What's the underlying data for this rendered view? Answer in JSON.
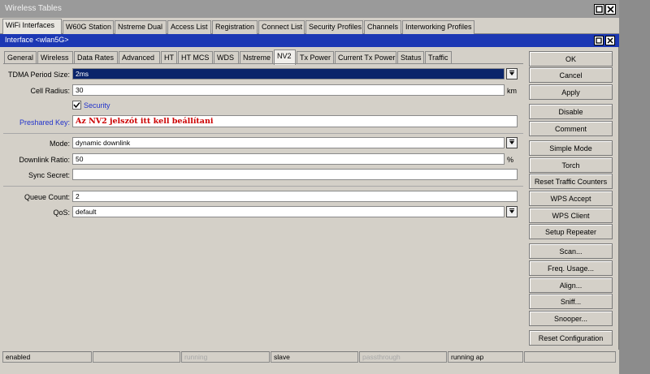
{
  "window": {
    "title": "Wireless Tables"
  },
  "outer_tabs": [
    "WiFi Interfaces",
    "W60G Station",
    "Nstreme Dual",
    "Access List",
    "Registration",
    "Connect List",
    "Security Profiles",
    "Channels",
    "Interworking Profiles"
  ],
  "outer_active_tab": "WiFi Interfaces",
  "dialog": {
    "title": "Interface <wlan5G>"
  },
  "inner_tabs": [
    "General",
    "Wireless",
    "Data Rates",
    "Advanced",
    "HT",
    "HT MCS",
    "WDS",
    "Nstreme",
    "NV2",
    "Tx Power",
    "Current Tx Power",
    "Status",
    "Traffic"
  ],
  "inner_active_tab": "NV2",
  "form": {
    "tdma_period_label": "TDMA Period Size:",
    "tdma_period_value": "2ms",
    "cell_radius_label": "Cell Radius:",
    "cell_radius_value": "30",
    "cell_radius_unit": "km",
    "security_label": "Security",
    "security_checked": true,
    "preshared_key_label": "Preshared Key:",
    "preshared_key_value": "Az NV2 jelszót itt kell beállítani",
    "mode_label": "Mode:",
    "mode_value": "dynamic downlink",
    "downlink_ratio_label": "Downlink Ratio:",
    "downlink_ratio_value": "50",
    "downlink_ratio_unit": "%",
    "sync_secret_label": "Sync Secret:",
    "sync_secret_value": "",
    "queue_count_label": "Queue Count:",
    "queue_count_value": "2",
    "qos_label": "QoS:",
    "qos_value": "default"
  },
  "buttons": {
    "ok": "OK",
    "cancel": "Cancel",
    "apply": "Apply",
    "disable": "Disable",
    "comment": "Comment",
    "simple_mode": "Simple Mode",
    "torch": "Torch",
    "reset_traffic_counters": "Reset Traffic Counters",
    "wps_accept": "WPS Accept",
    "wps_client": "WPS Client",
    "setup_repeater": "Setup Repeater",
    "scan": "Scan...",
    "freq_usage": "Freq. Usage...",
    "align": "Align...",
    "sniff": "Sniff...",
    "snooper": "Snooper...",
    "reset_configuration": "Reset Configuration"
  },
  "status_bar": {
    "state": "enabled",
    "empty1": "",
    "running": "running",
    "slave": "slave",
    "passthrough": "passthrough",
    "running_ap": "running ap",
    "empty2": ""
  },
  "colors": {
    "dialog_title_bg": "#1c38b4",
    "selected_field_bg": "#0a246a",
    "preshared_text": "#cc0000",
    "link_label": "#2233cc"
  }
}
